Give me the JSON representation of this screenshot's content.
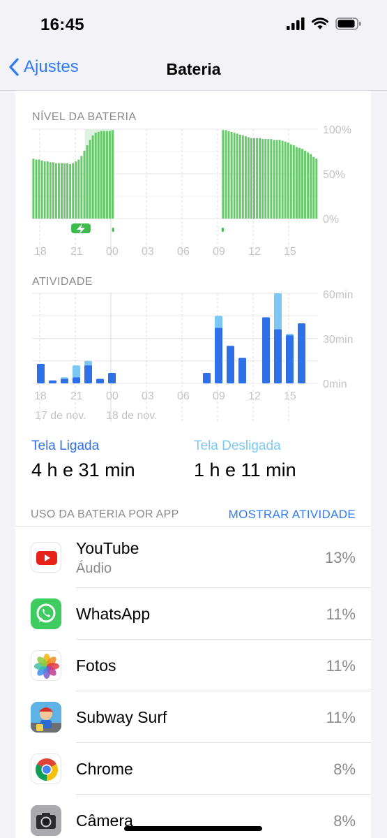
{
  "status_bar": {
    "time": "16:45"
  },
  "nav": {
    "back_label": "Ajustes",
    "title": "Bateria"
  },
  "battery_chart": {
    "section_label": "NÍVEL DA BATERIA",
    "y_ticks": [
      "100%",
      "50%",
      "0%"
    ],
    "x_ticks": [
      "18",
      "21",
      "00",
      "03",
      "06",
      "09",
      "12",
      "15"
    ]
  },
  "activity_chart": {
    "section_label": "ATIVIDADE",
    "y_ticks": [
      "60min",
      "30min",
      "0min"
    ],
    "x_ticks": [
      "18",
      "21",
      "00",
      "03",
      "06",
      "09",
      "12",
      "15"
    ],
    "date_labels": [
      "17 de nov.",
      "18 de nov."
    ]
  },
  "chart_data": [
    {
      "type": "bar",
      "title": "NÍVEL DA BATERIA",
      "unit": "%",
      "ylim": [
        0,
        100
      ],
      "y_ticks": [
        0,
        50,
        100
      ],
      "x_tick_labels": [
        "18",
        "21",
        "00",
        "03",
        "06",
        "09",
        "12",
        "15"
      ],
      "charging_window_hours": [
        21,
        23
      ],
      "grid": true,
      "series": [
        {
          "values": [
            67,
            66,
            66,
            65,
            64,
            64,
            63,
            63,
            62,
            62,
            62,
            62,
            62,
            61,
            62,
            64,
            66,
            70,
            76,
            82,
            88,
            93,
            96,
            97,
            98,
            98,
            98,
            98,
            99,
            null,
            null,
            null,
            null,
            null,
            null,
            null,
            null,
            null,
            null,
            null,
            null,
            null,
            null,
            null,
            null,
            null,
            null,
            null,
            null,
            null,
            null,
            null,
            null,
            null,
            null,
            null,
            null,
            null,
            null,
            null,
            null,
            null,
            null,
            null,
            null,
            null,
            null,
            99,
            99,
            98,
            97,
            96,
            95,
            94,
            93,
            92,
            91,
            90,
            90,
            90,
            90,
            89,
            89,
            89,
            89,
            88,
            88,
            88,
            87,
            86,
            85,
            83,
            82,
            80,
            79,
            78,
            76,
            74,
            72,
            69,
            67
          ]
        }
      ]
    },
    {
      "type": "bar",
      "title": "ATIVIDADE",
      "unit": "min",
      "ylim": [
        0,
        60
      ],
      "y_ticks": [
        0,
        30,
        60
      ],
      "categories": [
        "17h",
        "18h",
        "19h",
        "20h",
        "21h",
        "22h",
        "23h",
        "00h",
        "01h",
        "02h",
        "03h",
        "04h",
        "05h",
        "06h",
        "07h",
        "08h",
        "09h",
        "10h",
        "11h",
        "12h",
        "13h",
        "14h",
        "15h",
        "16h"
      ],
      "stacked": true,
      "series": [
        {
          "name": "Tela Ligada",
          "values": [
            13,
            2,
            3,
            4,
            12,
            3,
            7,
            0,
            0,
            0,
            0,
            0,
            0,
            0,
            7,
            37,
            25,
            17,
            0,
            44,
            36,
            32,
            40,
            0
          ]
        },
        {
          "name": "Tela Desligada",
          "values": [
            0,
            0,
            1,
            8,
            3,
            0,
            0,
            0,
            0,
            0,
            0,
            0,
            0,
            0,
            0,
            8,
            0,
            0,
            0,
            0,
            24,
            1,
            0,
            0
          ]
        }
      ]
    }
  ],
  "totals": {
    "on_label": "Tela Ligada",
    "on_value": "4 h e 31 min",
    "off_label": "Tela Desligada",
    "off_value": "1 h e 11 min"
  },
  "app_usage": {
    "header": "USO DA BATERIA POR APP",
    "action": "MOSTRAR ATIVIDADE",
    "apps": [
      {
        "name": "YouTube",
        "sub": "Áudio",
        "pct": "13%",
        "icon": "youtube-icon"
      },
      {
        "name": "WhatsApp",
        "sub": "",
        "pct": "11%",
        "icon": "whatsapp-icon"
      },
      {
        "name": "Fotos",
        "sub": "",
        "pct": "11%",
        "icon": "photos-icon"
      },
      {
        "name": "Subway Surf",
        "sub": "",
        "pct": "11%",
        "icon": "subway-surf-icon"
      },
      {
        "name": "Chrome",
        "sub": "",
        "pct": "8%",
        "icon": "chrome-icon"
      },
      {
        "name": "Câmera",
        "sub": "",
        "pct": "8%",
        "icon": "camera-icon"
      }
    ]
  },
  "colors": {
    "battery_green": "#67c96a",
    "charging_green": "#3dbb4c",
    "screen_on_blue": "#2f6fe8",
    "screen_off_blue": "#7cc8f2",
    "accent_blue": "#2f7bf5"
  }
}
